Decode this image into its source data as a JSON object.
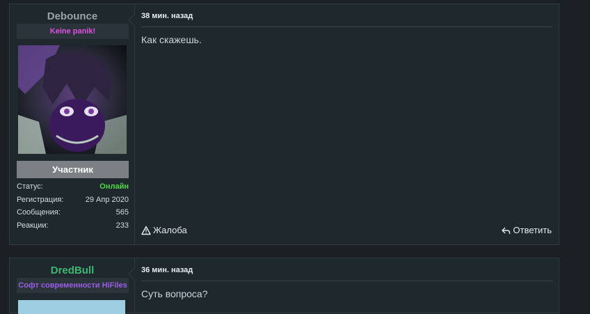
{
  "posts": [
    {
      "username": "Debounce",
      "username_color": "#9aa3a9",
      "user_title": "Keine panik!",
      "user_title_color": "#e14fe3",
      "role": "Участник",
      "stats": [
        {
          "label": "Статус:",
          "value": "Онлайн",
          "value_color": "#4fd94a"
        },
        {
          "label": "Регистрация:",
          "value": "29 Апр 2020"
        },
        {
          "label": "Сообщения:",
          "value": "565"
        },
        {
          "label": "Реакции:",
          "value": "233"
        }
      ],
      "time": "38 мин. назад",
      "message": "Как скажешь.",
      "report_label": "Жалоба",
      "reply_label": "Ответить"
    },
    {
      "username": "DredBull",
      "username_color": "#3db872",
      "user_title": "Софт современности HiFiles",
      "user_title_color": "#9b5de5",
      "time": "36 мин. назад",
      "message": "Суть вопроса?"
    }
  ],
  "icons": {
    "report": "warning-triangle-icon",
    "reply": "reply-arrow-icon"
  }
}
